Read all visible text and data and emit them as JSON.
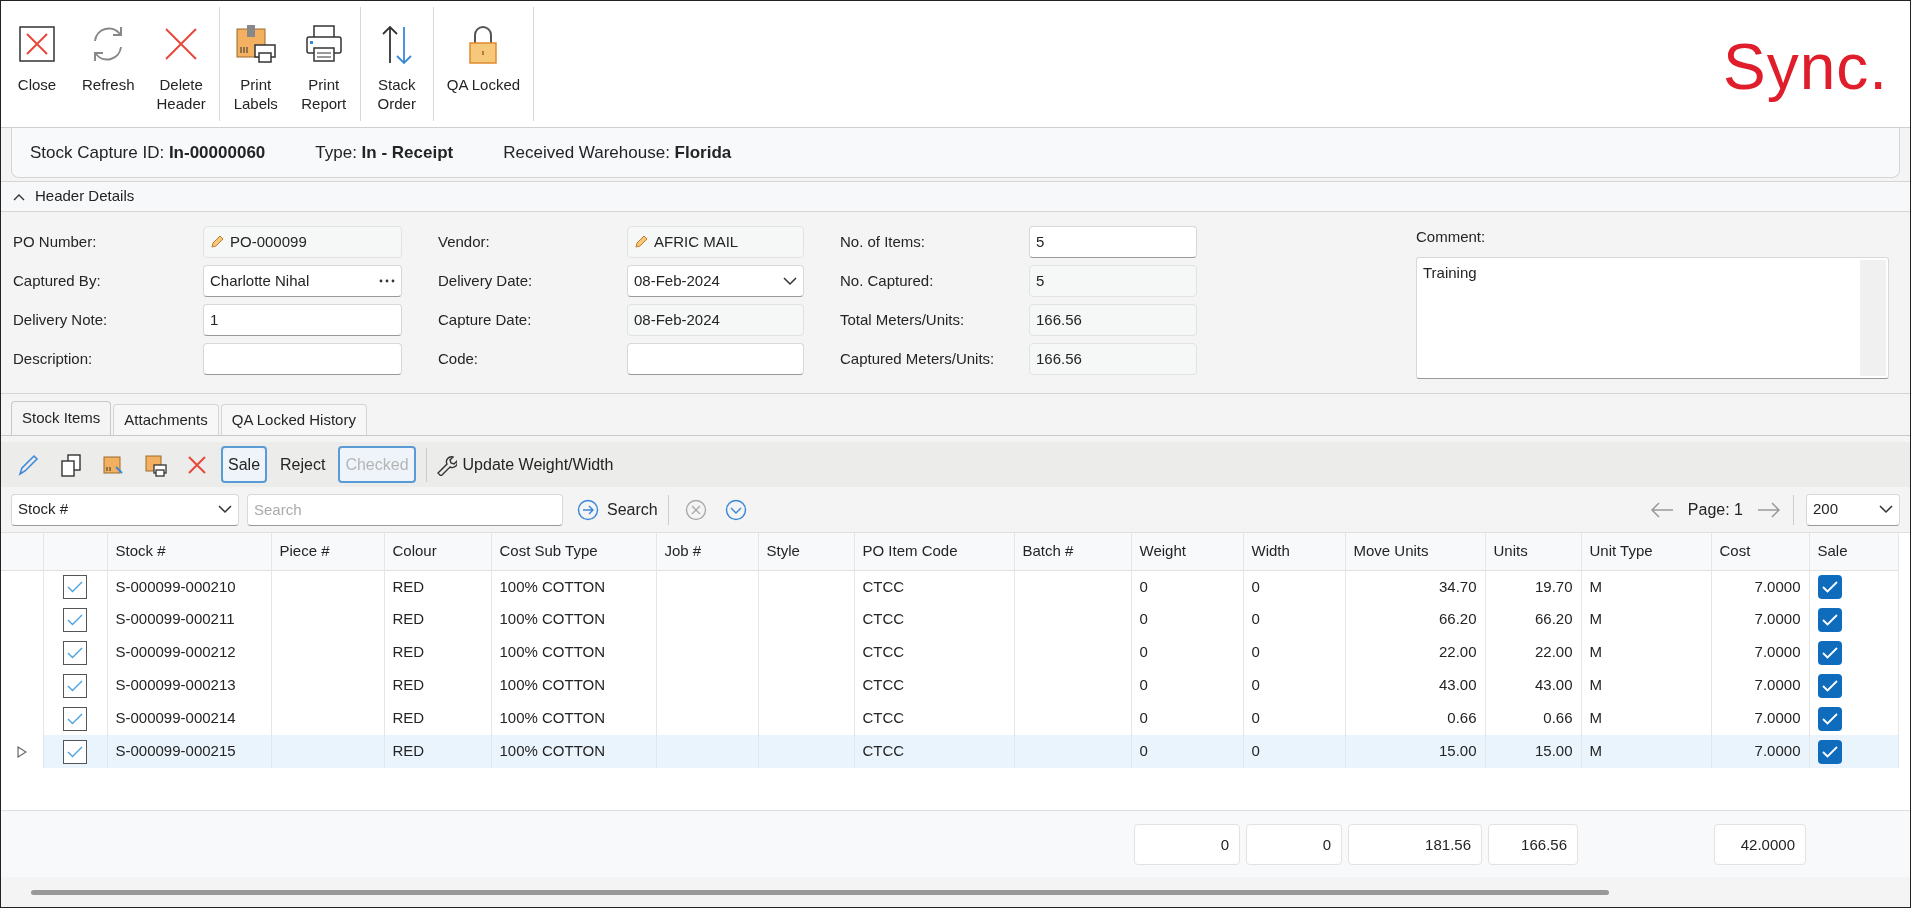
{
  "toolbar": {
    "groups": [
      [
        {
          "kind": "close",
          "label": "Close"
        },
        {
          "kind": "refresh",
          "label": "Refresh"
        },
        {
          "kind": "delete",
          "label": "Delete\nHeader"
        }
      ],
      [
        {
          "kind": "labels",
          "label": "Print\nLabels"
        },
        {
          "kind": "report",
          "label": "Print\nReport"
        }
      ],
      [
        {
          "kind": "stack",
          "label": "Stack\nOrder"
        }
      ],
      [
        {
          "kind": "lock",
          "label": "QA Locked"
        }
      ]
    ],
    "logo": "Sync."
  },
  "info": [
    "Stock Capture ID: **In-00000060**",
    "Type: **In - Receipt**",
    "Received Warehouse: **Florida**"
  ],
  "header_details": {
    "title": "Header Details",
    "expanded": true,
    "columns": [
      [
        {
          "label": "PO Number:",
          "value": "PO-000099",
          "kind": "link",
          "readonly": true
        },
        {
          "label": "Captured By:",
          "value": "Charlotte Nihal",
          "kind": "lookup",
          "readonly": false
        },
        {
          "label": "Delivery Note:",
          "value": "1",
          "kind": "text",
          "readonly": false
        },
        {
          "label": "Description:",
          "kind": "text",
          "readonly": false
        }
      ],
      [
        {
          "label": "Vendor:",
          "value": "AFRIC MAIL",
          "kind": "link",
          "readonly": true
        },
        {
          "label": "Delivery Date:",
          "value": "08-Feb-2024",
          "kind": "dropdown",
          "readonly": false
        },
        {
          "label": "Capture Date:",
          "value": "08-Feb-2024",
          "kind": "text",
          "readonly": true
        },
        {
          "label": "Code:",
          "kind": "text",
          "readonly": false
        }
      ],
      [
        {
          "label": "No. of Items:",
          "value": "5",
          "kind": "text",
          "readonly": false
        },
        {
          "label": "No. Captured:",
          "value": "5",
          "kind": "text",
          "readonly": true
        },
        {
          "label": "Total Meters/Units:",
          "value": "166.56",
          "kind": "text",
          "readonly": true
        },
        {
          "label": "Captured Meters/Units:",
          "value": "166.56",
          "kind": "text",
          "readonly": true
        }
      ]
    ],
    "comment": {
      "label": "Comment:",
      "value": "Training"
    }
  },
  "tabs": [
    {
      "label": "Stock Items",
      "selected": true
    },
    {
      "label": "Attachments",
      "selected": false
    },
    {
      "label": "QA Locked History",
      "selected": false
    }
  ],
  "grid_toolbar": [
    {
      "kind": "edit"
    },
    {
      "kind": "copy"
    },
    {
      "kind": "batch"
    },
    {
      "kind": "print"
    },
    {
      "kind": "delete"
    },
    {
      "kind": "button",
      "label": "Sale",
      "pressed": true,
      "disabled": false
    },
    {
      "kind": "button",
      "label": "Reject",
      "pressed": false,
      "disabled": false
    },
    {
      "kind": "button",
      "label": "Checked",
      "pressed": true,
      "disabled": true
    },
    {
      "kind": "wrench",
      "label": "Update Weight/Width"
    }
  ],
  "filter": {
    "field": "Stock #",
    "search_placeholder": "Search",
    "search_button": "Search"
  },
  "pager": {
    "page": "Page: 1",
    "page_size": "200"
  },
  "table": {
    "columns": [
      {
        "label": "Stock #",
        "kind": "text"
      },
      {
        "label": "Piece #",
        "kind": "text"
      },
      {
        "label": "Colour",
        "kind": "text"
      },
      {
        "label": "Cost Sub Type",
        "kind": "text"
      },
      {
        "label": "Job #",
        "kind": "text"
      },
      {
        "label": "Style",
        "kind": "text"
      },
      {
        "label": "PO Item Code",
        "kind": "text"
      },
      {
        "label": "Batch #",
        "kind": "text"
      },
      {
        "label": "Weight",
        "kind": "text",
        "total": "0"
      },
      {
        "label": "Width",
        "kind": "text",
        "total": "0"
      },
      {
        "label": "Move Units",
        "kind": "number",
        "total": "181.56"
      },
      {
        "label": "Units",
        "kind": "number",
        "total": "166.56"
      },
      {
        "label": "Unit Type",
        "kind": "text"
      },
      {
        "label": "Cost",
        "kind": "number",
        "total": "42.0000"
      },
      {
        "label": "Sale",
        "kind": "check"
      }
    ],
    "rows": [
      {
        "current": false,
        "checked": true,
        "sale": true,
        "cells": [
          "S-000099-000210",
          null,
          "RED",
          "100% COTTON",
          null,
          null,
          "CTCC",
          null,
          "0",
          "0",
          "34.70",
          "19.70",
          "M",
          "7.0000"
        ]
      },
      {
        "current": false,
        "checked": true,
        "sale": true,
        "cells": [
          "S-000099-000211",
          null,
          "RED",
          "100% COTTON",
          null,
          null,
          "CTCC",
          null,
          "0",
          "0",
          "66.20",
          "66.20",
          "M",
          "7.0000"
        ]
      },
      {
        "current": false,
        "checked": true,
        "sale": true,
        "cells": [
          "S-000099-000212",
          null,
          "RED",
          "100% COTTON",
          null,
          null,
          "CTCC",
          null,
          "0",
          "0",
          "22.00",
          "22.00",
          "M",
          "7.0000"
        ]
      },
      {
        "current": false,
        "checked": true,
        "sale": true,
        "cells": [
          "S-000099-000213",
          null,
          "RED",
          "100% COTTON",
          null,
          null,
          "CTCC",
          null,
          "0",
          "0",
          "43.00",
          "43.00",
          "M",
          "7.0000"
        ]
      },
      {
        "current": false,
        "checked": true,
        "sale": true,
        "cells": [
          "S-000099-000214",
          null,
          "RED",
          "100% COTTON",
          null,
          null,
          "CTCC",
          null,
          "0",
          "0",
          "0.66",
          "0.66",
          "M",
          "7.0000"
        ]
      },
      {
        "current": true,
        "checked": true,
        "sale": true,
        "cells": [
          "S-000099-000215",
          null,
          "RED",
          "100% COTTON",
          null,
          null,
          "CTCC",
          null,
          "0",
          "0",
          "15.00",
          "15.00",
          "M",
          "7.0000"
        ]
      }
    ]
  }
}
